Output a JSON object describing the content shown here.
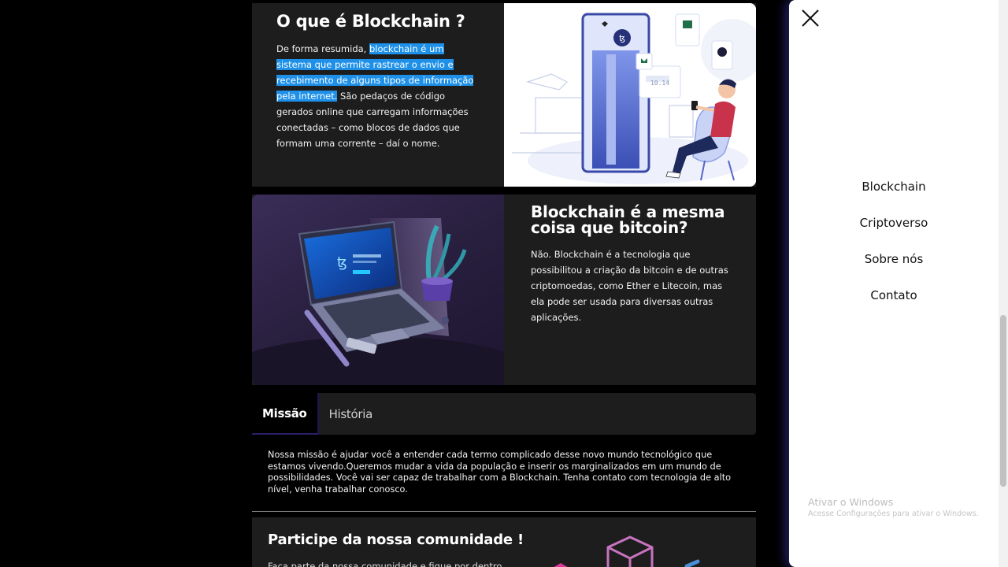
{
  "section1": {
    "title": "O que é Blockchain ?",
    "body_prefix": "De forma resumida, ",
    "body_highlight": "blockchain é um sistema que permite rastrear o envio e recebimento de alguns tipos de informação pela internet.",
    "body_suffix": " São pedaços de código gerados online que carregam informações conectadas – como blocos de dados que formam uma corrente – daí o nome.",
    "illus_counter": "10.14"
  },
  "section2": {
    "title": "Blockchain é a mesma coisa que bitcoin?",
    "body": "Não. Blockchain é a tecnologia que possibilitou a criação da bitcoin e de outras criptomoedas, como Ether e Litecoin, mas ela pode ser usada para diversas outras aplicações."
  },
  "tabs": [
    {
      "label": "Missão",
      "active": true
    },
    {
      "label": "História",
      "active": false
    }
  ],
  "mission": {
    "text": "Nossa missão é ajudar você a entender cada termo complicado desse novo mundo tecnológico que estamos vivendo.Queremos mudar a vida da população e inserir os marginalizados em um mundo de possibilidades. Você vai ser capaz de trabalhar com a Blockchain. Tenha contato com tecnologia de alto nível, venha trabalhar conosco."
  },
  "community": {
    "title": "Participe da nossa comunidade !",
    "body": "Faça parte da nossa comunidade e fique por dentro"
  },
  "sidemenu": {
    "items": [
      "Blockchain",
      "Criptoverso",
      "Sobre nós",
      "Contato"
    ]
  },
  "windows_notice": {
    "title": "Ativar o Windows",
    "subtitle": "Acesse Configurações para ativar o Windows."
  },
  "colors": {
    "highlight": "#1e90e8",
    "panel": "#1d1d1d",
    "menu_glow": "#463cc8"
  }
}
